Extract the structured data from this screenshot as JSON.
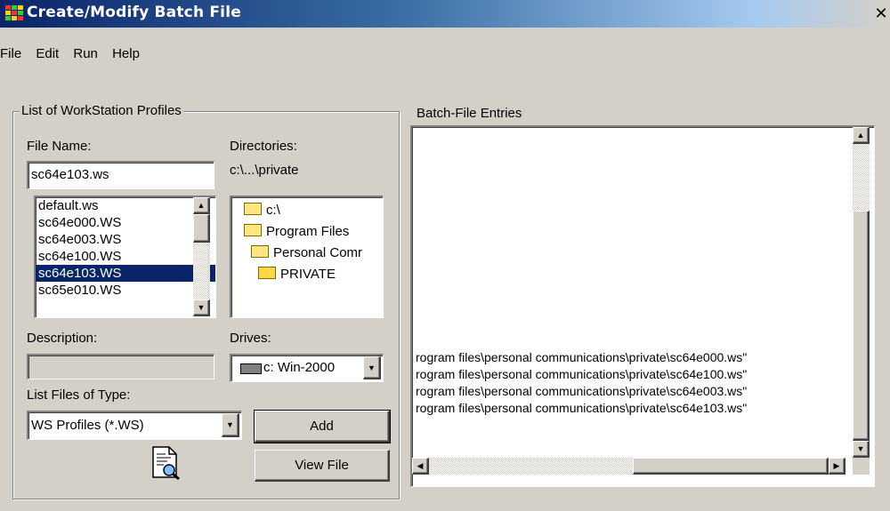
{
  "window": {
    "title": "Create/Modify Batch File",
    "close_glyph": "✕"
  },
  "menu": [
    "File",
    "Edit",
    "Run",
    "Help"
  ],
  "profiles": {
    "legend": "List of WorkStation Profiles",
    "file_name_label": "File Name:",
    "file_name_value": "sc64e103.ws",
    "files": [
      "default.ws",
      "sc64e000.WS",
      "sc64e003.WS",
      "sc64e100.WS",
      "sc64e103.WS",
      "sc65e010.WS"
    ],
    "selected_file_index": 4,
    "directories_label": "Directories:",
    "current_dir": "c:\\...\\private",
    "dir_tree": [
      "c:\\",
      "Program Files",
      "Personal Comr",
      "PRIVATE"
    ],
    "description_label": "Description:",
    "description_value": "",
    "drives_label": "Drives:",
    "drive_value": "c: Win-2000",
    "list_type_label": "List Files of Type:",
    "list_type_value": "WS Profiles (*.WS)",
    "add_button": "Add",
    "view_button": "View File"
  },
  "batch": {
    "label": "Batch-File Entries",
    "entries": [
      "rogram files\\personal communications\\private\\sc64e000.ws\"",
      "rogram files\\personal communications\\private\\sc64e100.ws\"",
      "rogram files\\personal communications\\private\\sc64e003.ws\"",
      "rogram files\\personal communications\\private\\sc64e103.ws\""
    ]
  },
  "icons": {
    "app": "batch-app-icon",
    "view_doc": "document-magnifier-icon",
    "folder": "folder-icon",
    "drive": "drive-icon"
  },
  "colors": {
    "title_start": "#0a246a",
    "selection": "#0a246a",
    "face": "#d4d0c8"
  }
}
